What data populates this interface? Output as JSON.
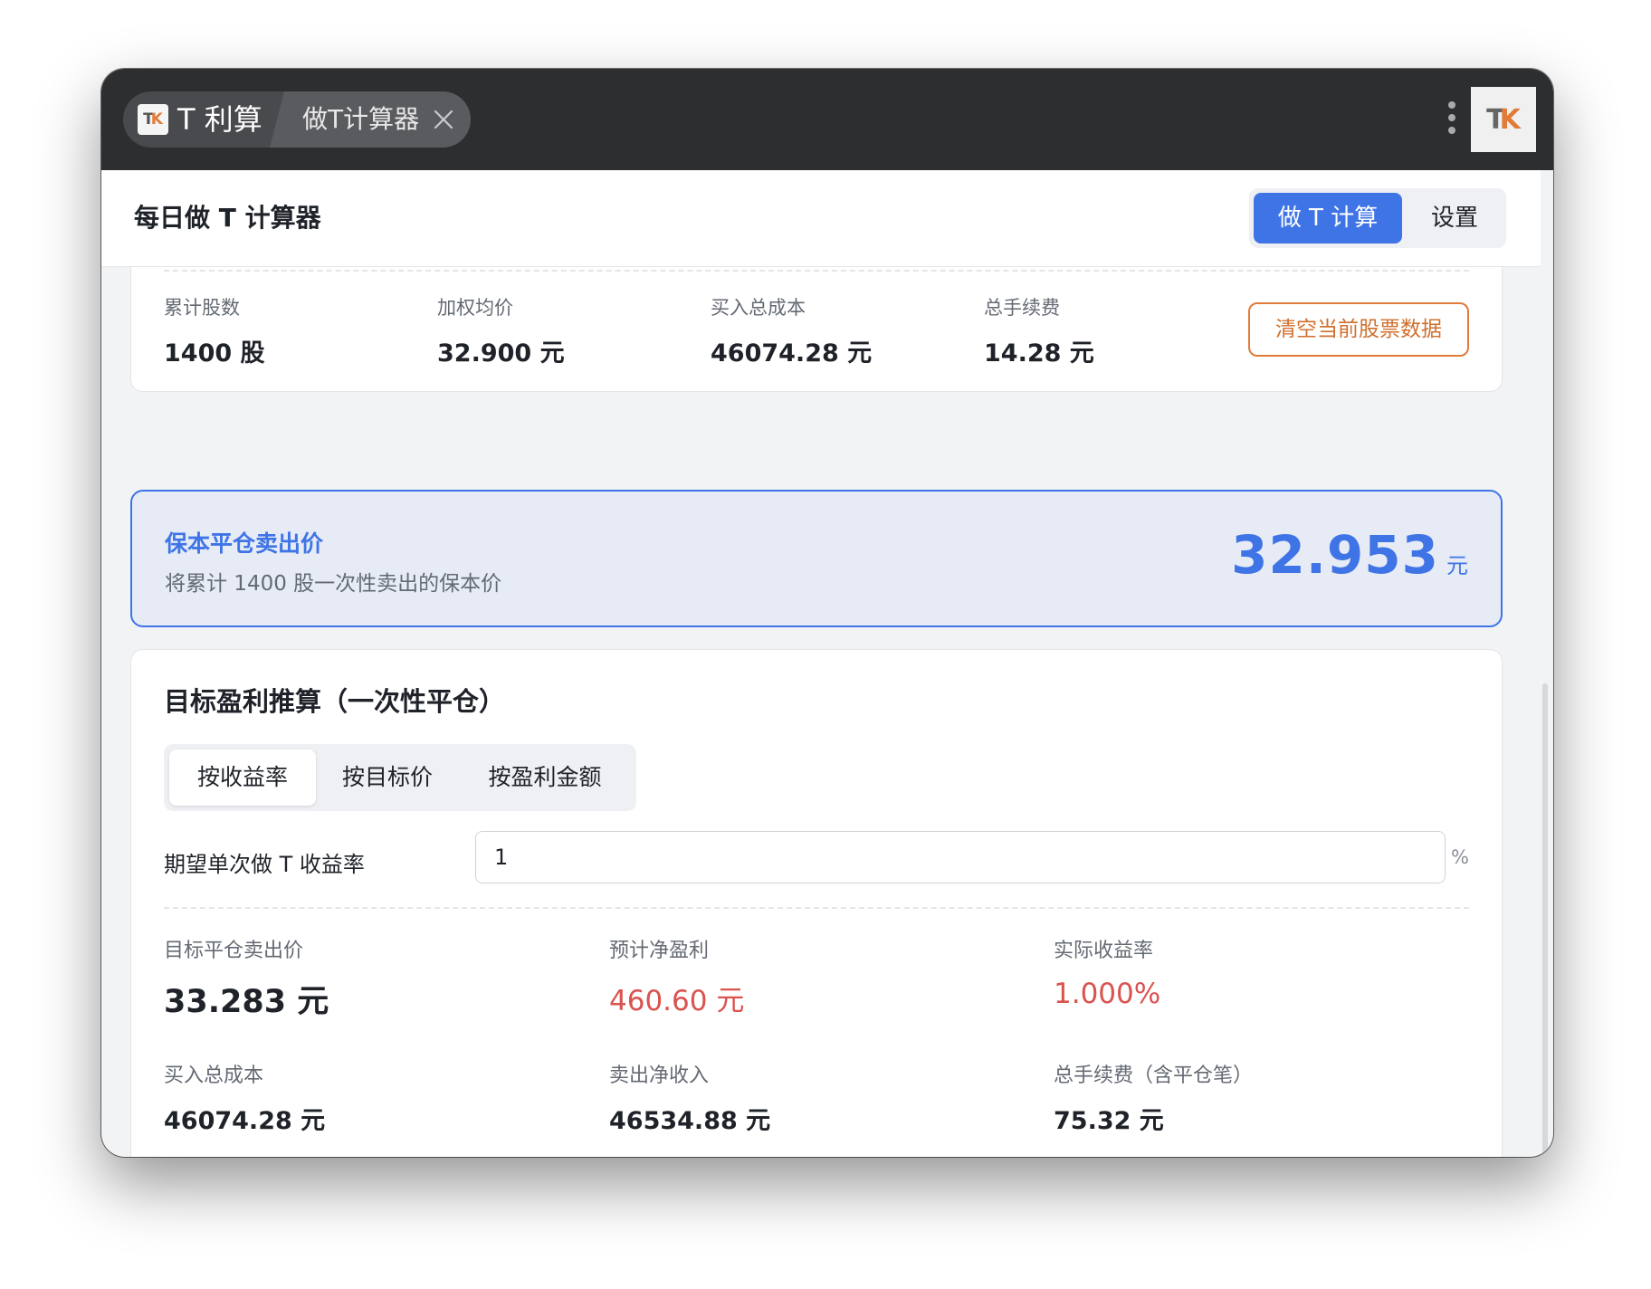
{
  "titlebar": {
    "app_tab_label": "T 利算",
    "logo_letters": [
      "T",
      "K"
    ],
    "active_tab_label": "做T计算器",
    "avatar_letters": [
      "T",
      "K"
    ]
  },
  "header": {
    "title": "每日做 T 计算器",
    "nav": {
      "calc_label": "做 T 计算",
      "settings_label": "设置"
    }
  },
  "summary": {
    "stats": [
      {
        "label": "累计股数",
        "value": "1400 股"
      },
      {
        "label": "加权均价",
        "value": "32.900 元"
      },
      {
        "label": "买入总成本",
        "value": "46074.28 元"
      },
      {
        "label": "总手续费",
        "value": "14.28 元"
      }
    ],
    "clear_button_label": "清空当前股票数据"
  },
  "breakeven": {
    "title": "保本平仓卖出价",
    "subtitle": "将累计 1400 股一次性卖出的保本价",
    "value": "32.953",
    "unit": "元"
  },
  "target": {
    "title": "目标盈利推算（一次性平仓）",
    "modes": [
      "按收益率",
      "按目标价",
      "按盈利金额"
    ],
    "active_mode_index": 0,
    "input_label": "期望单次做 T 收益率",
    "input_value": "1",
    "input_unit": "%",
    "results": [
      {
        "label": "目标平仓卖出价",
        "value": "33.283 元"
      },
      {
        "label": "预计净盈利",
        "value": "460.60 元"
      },
      {
        "label": "实际收益率",
        "value": "1.000%"
      },
      {
        "label": "买入总成本",
        "value": "46074.28 元"
      },
      {
        "label": "卖出净收入",
        "value": "46534.88 元"
      },
      {
        "label": "总手续费（含平仓笔）",
        "value": "75.32 元"
      }
    ]
  },
  "colors": {
    "accent": "#3f74e6",
    "warning": "#e07b39",
    "profit": "#d9534f",
    "titlebar": "#2d2e30"
  }
}
